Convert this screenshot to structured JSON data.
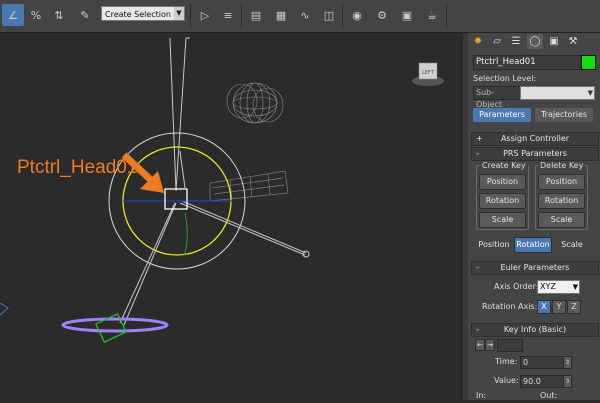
{
  "toolbar": {
    "selection_set_placeholder": "Create Selection Se",
    "icons": [
      "snap-toggle-icon",
      "percent-snap-icon",
      "spinner-snap-icon",
      "edit-named-selection-icon",
      "mirror-icon",
      "align-icon",
      "layer-manager-icon",
      "scene-explorer-icon",
      "curve-editor-icon",
      "schematic-view-icon",
      "material-editor-icon",
      "render-setup-icon",
      "render-frame-icon",
      "render-icon"
    ]
  },
  "viewport": {
    "annotation": "Ptctrl_Head01",
    "viewcube_label": "LEFT"
  },
  "command_panel": {
    "object_name": "Ptctrl_Head01",
    "object_color": "#11dd11",
    "selection_level_label": "Selection Level:",
    "sub_object_label": "Sub-Object",
    "tabs": {
      "parameters": "Parameters",
      "trajectories": "Trajectories"
    },
    "assign_controller": {
      "sign": "+",
      "title": "Assign Controller"
    },
    "prs": {
      "sign": "-",
      "title": "PRS Parameters",
      "create_key_title": "Create Key",
      "delete_key_title": "Delete Key",
      "create_buttons": [
        "Position",
        "Rotation",
        "Scale"
      ],
      "delete_buttons": [
        "Position",
        "Rotation",
        "Scale"
      ],
      "mode_buttons": [
        "Position",
        "Rotation",
        "Scale"
      ],
      "active_mode": "Rotation"
    },
    "euler": {
      "sign": "-",
      "title": "Euler Parameters",
      "axis_order_label": "Axis Order:",
      "axis_order_value": "XYZ",
      "rotation_axis_label": "Rotation Axis:",
      "axes": [
        "X",
        "Y",
        "Z"
      ],
      "active_axis": "X"
    },
    "key_info": {
      "sign": "-",
      "title": "Key Info (Basic)",
      "time_label": "Time:",
      "time_value": "0",
      "value_label": "Value:",
      "value_value": "90.0",
      "in_label": "In:",
      "out_label": "Out:"
    }
  },
  "colors": {
    "accent": "#4a78b4",
    "annotation": "#f07a22",
    "selection_ring": "#e8e820"
  }
}
